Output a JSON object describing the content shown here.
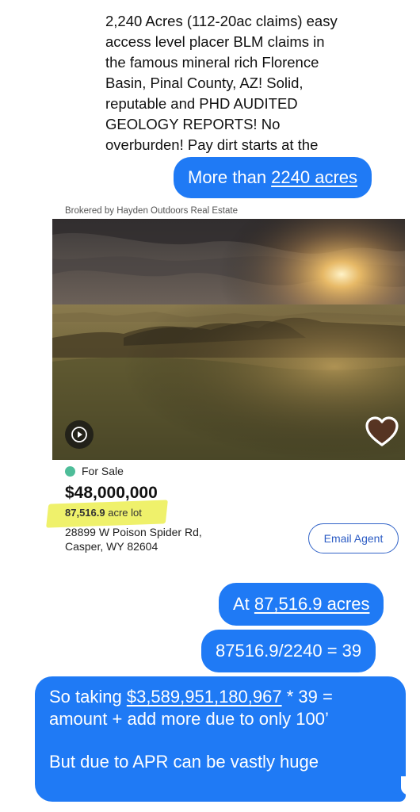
{
  "quoted_message": {
    "lines": [
      "2,240 Acres (112-20ac claims) easy",
      "access level placer BLM claims in",
      "the famous mineral rich Florence",
      "Basin, Pinal County, AZ! Solid,",
      "reputable and PHD AUDITED",
      "GEOLOGY REPORTS! No",
      "overburden! Pay dirt starts at the"
    ]
  },
  "messages": {
    "m1": {
      "prefix": "More than ",
      "link": "2240 acres"
    },
    "m2": {
      "prefix": "At ",
      "link": "87,516.9 acres"
    },
    "m3": {
      "text": "87516.9/2240 = 39"
    },
    "m4": {
      "line1_prefix": "So taking ",
      "line1_link": "$3,589,951,180,967",
      "line1_suffix": " * 39 =",
      "line2": "amount + add more due to only 100’",
      "line3": "But due to APR can be vastly huge"
    }
  },
  "listing": {
    "broker": "Brokered by Hayden Outdoors Real Estate",
    "status": "For Sale",
    "price": "$48,000,000",
    "lot_number": "87,516.9",
    "lot_unit": " acre lot",
    "address_line1": "28899 W Poison Spider Rd,",
    "address_line2": "Casper, WY 82604",
    "email_button": "Email Agent",
    "play_icon": "play-icon",
    "heart_icon": "heart-icon"
  },
  "colors": {
    "bubble_blue": "#1f7af5",
    "status_green": "#4ebd99",
    "highlight_yellow": "#e9ec3a",
    "button_blue": "#2c5cc4"
  }
}
